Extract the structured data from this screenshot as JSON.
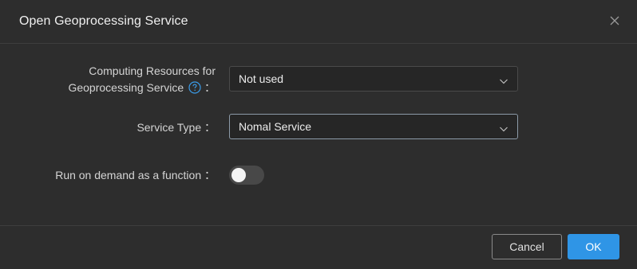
{
  "dialog": {
    "title": "Open Geoprocessing Service",
    "close_icon": "close-icon"
  },
  "form": {
    "computing_resources": {
      "label": "Computing Resources for Geoprocessing Service",
      "suffix": "：",
      "help_icon": "help-circle-icon",
      "value": "Not used"
    },
    "service_type": {
      "label": "Service Type ：",
      "value": "Nomal Service"
    },
    "run_on_demand": {
      "label": "Run on demand as a function ：",
      "enabled": false
    }
  },
  "footer": {
    "cancel_label": "Cancel",
    "ok_label": "OK"
  },
  "colors": {
    "background": "#2d2d2d",
    "accent": "#2f95e6",
    "help_icon": "#3a9be8"
  }
}
